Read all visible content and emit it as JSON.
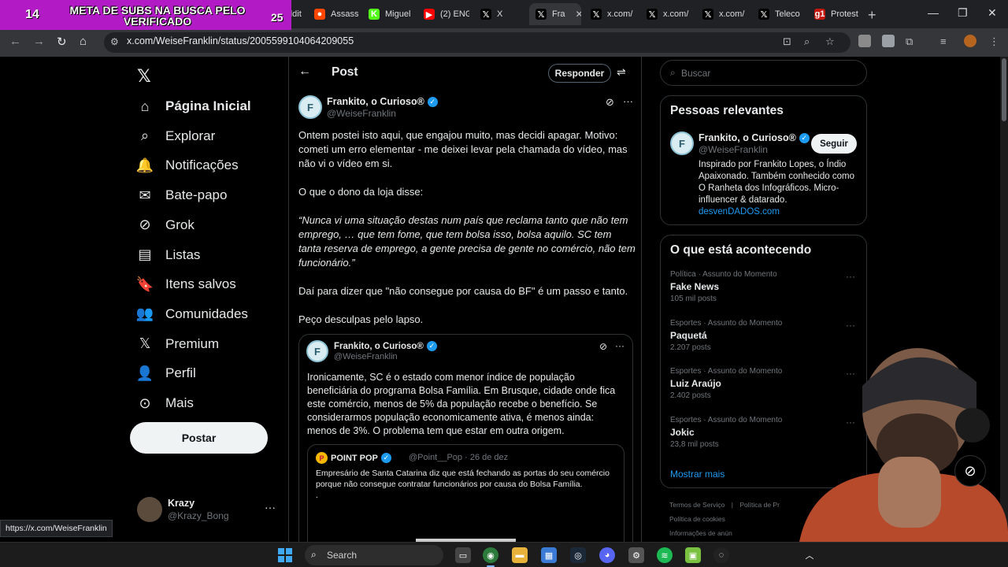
{
  "overlay": {
    "left_number": "14",
    "banner_text": "META DE SUBS NA BUSCA PELO VERIFICADO",
    "right_number": "25"
  },
  "browser": {
    "tabs": [
      {
        "label": "Reddit",
        "color": "#ff4500",
        "glyph": "●"
      },
      {
        "label": "Assassi",
        "color": "#ff4500",
        "glyph": "●"
      },
      {
        "label": "Miguel",
        "color": "#53fc18",
        "glyph": "K"
      },
      {
        "label": "(2) ENG",
        "color": "#ff0000",
        "glyph": "▶"
      },
      {
        "label": "X",
        "color": "#000000",
        "glyph": "𝕏"
      },
      {
        "label": "Fra",
        "color": "#000000",
        "glyph": "𝕏",
        "active": true
      },
      {
        "label": "x.com/",
        "color": "#000000",
        "glyph": "𝕏"
      },
      {
        "label": "x.com/",
        "color": "#000000",
        "glyph": "𝕏"
      },
      {
        "label": "x.com/",
        "color": "#000000",
        "glyph": "𝕏"
      },
      {
        "label": "Teleco",
        "color": "#000000",
        "glyph": "𝕏"
      },
      {
        "label": "Protest",
        "color": "#c4170c",
        "glyph": "g1"
      }
    ],
    "url": "x.com/WeiseFranklin/status/2005599104064209055",
    "status_url": "https://x.com/WeiseFranklin"
  },
  "nav": {
    "items": [
      {
        "label": "Página Inicial",
        "icon": "home-icon",
        "glyph": "⌂"
      },
      {
        "label": "Explorar",
        "icon": "search-icon",
        "glyph": "⌕"
      },
      {
        "label": "Notificações",
        "icon": "bell-icon",
        "glyph": "🔔"
      },
      {
        "label": "Bate-papo",
        "icon": "mail-icon",
        "glyph": "✉"
      },
      {
        "label": "Grok",
        "icon": "grok-icon",
        "glyph": "⊘"
      },
      {
        "label": "Listas",
        "icon": "list-icon",
        "glyph": "▤"
      },
      {
        "label": "Itens salvos",
        "icon": "bookmark-icon",
        "glyph": "🔖"
      },
      {
        "label": "Comunidades",
        "icon": "communities-icon",
        "glyph": "👥"
      },
      {
        "label": "Premium",
        "icon": "x-logo-icon",
        "glyph": "𝕏"
      },
      {
        "label": "Perfil",
        "icon": "profile-icon",
        "glyph": "👤"
      },
      {
        "label": "Mais",
        "icon": "more-circle-icon",
        "glyph": "⊙"
      }
    ],
    "post_button": "Postar",
    "account": {
      "name": "Krazy",
      "handle": "@Krazy_Bong"
    }
  },
  "header": {
    "title": "Post",
    "reply_button": "Responder"
  },
  "post": {
    "name": "Frankito, o Curioso®",
    "handle": "@WeiseFranklin",
    "avatar_text": "F",
    "p1": "Ontem postei isto aqui, que engajou muito, mas decidi apagar. Motivo: cometi um erro elementar - me deixei levar pela chamada do vídeo, mas não vi o vídeo em si.",
    "p2": "O que o dono da loja disse:",
    "p3": "“Nunca vi uma situação destas num país que reclama tanto que não tem emprego, … que tem fome, que tem bolsa isso, bolsa aquilo. SC tem tanta reserva de emprego, a gente precisa de gente no comércio, não tem funcionário.”",
    "p4": "Daí para dizer que \"não consegue por causa do BF\" é um passo e tanto.",
    "p5": "Peço desculpas pelo lapso."
  },
  "quote": {
    "name": "Frankito, o Curioso®",
    "handle": "@WeiseFranklin",
    "body": "Ironicamente, SC é o estado com menor índice de população beneficiária do programa Bolsa Família. Em Brusque, cidade onde fica este comércio, menos de 5% da população recebe o benefício. Se considerarmos população economicamente ativa, é menos ainda: menos de 3%. O problema tem que estar em outra origem.",
    "nested": {
      "name": "POINT POP",
      "meta": "@Point__Pop · 26 de dez",
      "body": "Empresário de Santa Catarina diz que está fechando as portas do seu comércio porque não consegue contratar funcionários por causa do Bolsa Família.",
      "dot": "."
    }
  },
  "right": {
    "search_placeholder": "Buscar",
    "relevant_title": "Pessoas relevantes",
    "relevant": {
      "name": "Frankito, o Curioso®",
      "handle": "@WeiseFranklin",
      "follow": "Seguir",
      "bio": "Inspirado por Frankito Lopes, o Índio Apaixonado. Também conhecido como O Ranheta dos Infográficos. Micro-influencer & datarado.",
      "link": "desvenDADOS.com"
    },
    "trends_title": "O que está acontecendo",
    "trends": [
      {
        "category": "Política · Assunto do Momento",
        "name": "Fake News",
        "posts": "105 mil posts"
      },
      {
        "category": "Esportes · Assunto do Momento",
        "name": "Paquetá",
        "posts": "2.207 posts"
      },
      {
        "category": "Esportes · Assunto do Momento",
        "name": "Luiz Araújo",
        "posts": "2.402 posts"
      },
      {
        "category": "Esportes · Assunto do Momento",
        "name": "Jokic",
        "posts": "23,8 mil posts"
      }
    ],
    "show_more": "Mostrar mais",
    "footer": [
      "Termos de Serviço",
      "Política de Pr",
      "Política de cookies",
      "Informações de anún"
    ]
  },
  "taskbar": {
    "search": "Search"
  }
}
